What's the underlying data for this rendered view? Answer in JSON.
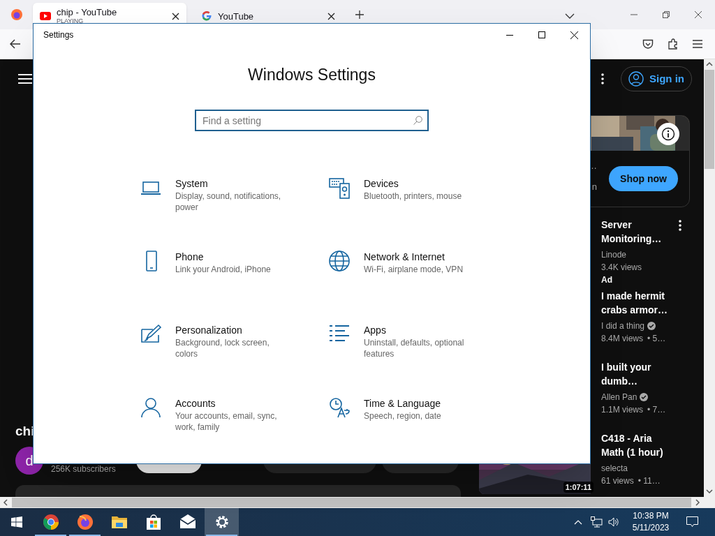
{
  "browser": {
    "tabs": [
      {
        "title": "chip - YouTube",
        "subtitle": "PLAYING",
        "selected": true
      },
      {
        "title": "YouTube",
        "selected": false
      }
    ]
  },
  "page": {
    "sign_in": "Sign in",
    "ad": {
      "texts": [
        "…",
        "n"
      ],
      "button": "Shop now"
    },
    "videos": [
      {
        "title": "Server Monitoring…",
        "channel": "Linode",
        "verified": false,
        "views": "3.4K views",
        "badge": "Ad"
      },
      {
        "title": "I made hermit crabs armor…",
        "channel": "I did a thing",
        "verified": true,
        "views": "8.4M views",
        "age": "• 5…"
      },
      {
        "title": "I built your dumb…",
        "channel": "Allen Pan",
        "verified": true,
        "views": "1.1M views",
        "age": "• 7…"
      },
      {
        "title": "C418 - Aria Math (1 hour)",
        "channel": "selecta",
        "verified": false,
        "views": "61 views",
        "age": "• 11…",
        "duration": "1:07:11"
      }
    ],
    "channel": {
      "title": "chi",
      "avatar": "d",
      "subscribers": "256K subscribers"
    }
  },
  "settings": {
    "title": "Settings",
    "heading": "Windows Settings",
    "search": {
      "placeholder": "Find a setting"
    },
    "items": [
      {
        "kind": "system",
        "title": "System",
        "description": "Display, sound, notifications, power"
      },
      {
        "kind": "devices",
        "title": "Devices",
        "description": "Bluetooth, printers, mouse"
      },
      {
        "kind": "phone",
        "title": "Phone",
        "description": "Link your Android, iPhone"
      },
      {
        "kind": "network",
        "title": "Network & Internet",
        "description": "Wi-Fi, airplane mode, VPN"
      },
      {
        "kind": "personalization",
        "title": "Personalization",
        "description": "Background, lock screen, colors"
      },
      {
        "kind": "apps",
        "title": "Apps",
        "description": "Uninstall, defaults, optional features"
      },
      {
        "kind": "accounts",
        "title": "Accounts",
        "description": "Your accounts, email, sync, work, family"
      },
      {
        "kind": "time",
        "title": "Time & Language",
        "description": "Speech, region, date"
      }
    ]
  },
  "taskbar": {
    "apps": [
      {
        "kind": "chrome",
        "running": true,
        "selected": false
      },
      {
        "kind": "firefox",
        "running": true,
        "selected": false
      },
      {
        "kind": "explorer",
        "running": false,
        "selected": false
      },
      {
        "kind": "store",
        "running": false,
        "selected": false
      },
      {
        "kind": "mail",
        "running": false,
        "selected": false
      },
      {
        "kind": "settings",
        "running": true,
        "selected": true
      }
    ],
    "time": "10:38 PM",
    "date": "5/11/2023"
  }
}
